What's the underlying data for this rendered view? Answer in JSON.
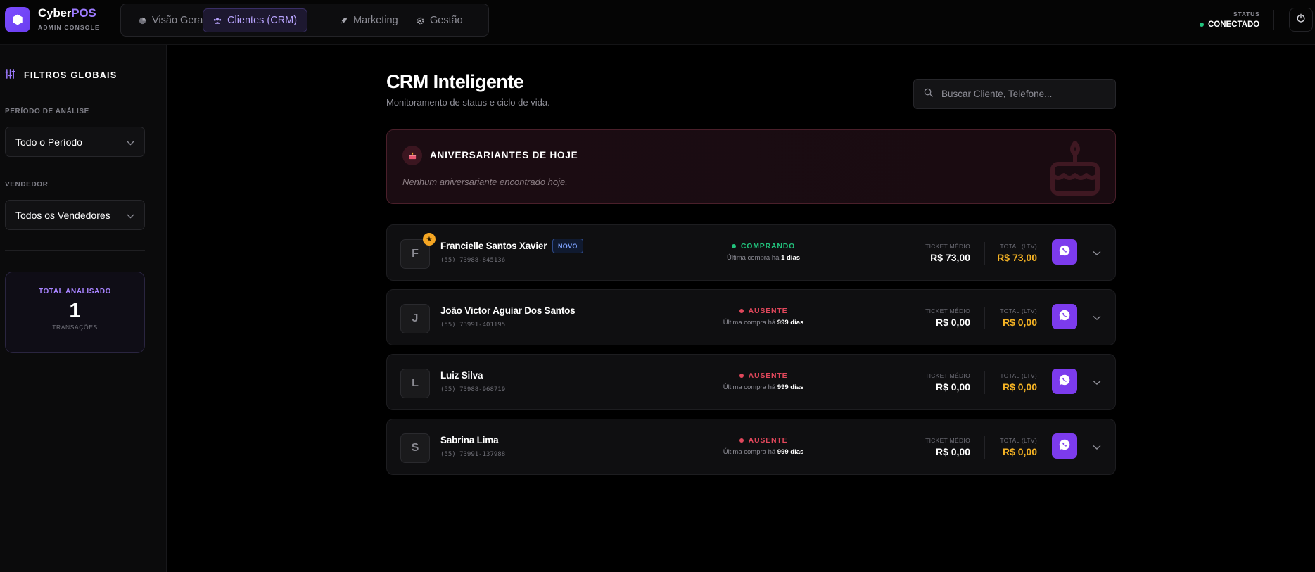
{
  "app": {
    "name_a": "Cyber",
    "name_b": "POS",
    "subtitle": "ADMIN CONSOLE"
  },
  "nav": [
    {
      "label": "Visão Geral",
      "icon": "chart-pie-icon",
      "active": false
    },
    {
      "label": "Clientes (CRM)",
      "icon": "users-icon",
      "active": true
    },
    {
      "label": "Marketing",
      "icon": "rocket-icon",
      "active": false
    },
    {
      "label": "Gestão",
      "icon": "gear-icon",
      "active": false
    }
  ],
  "status": {
    "label": "STATUS",
    "value": "CONECTADO"
  },
  "sidebar": {
    "title": "FILTROS GLOBAIS",
    "period_label": "PERÍODO DE ANÁLISE",
    "period_value": "Todo o Período",
    "seller_label": "VENDEDOR",
    "seller_value": "Todos os Vendedores",
    "total_title": "TOTAL ANALISADO",
    "total_value": "1",
    "total_sub": "TRANSAÇÕES"
  },
  "main": {
    "title": "CRM Inteligente",
    "subtitle": "Monitoramento de status e ciclo de vida.",
    "search_placeholder": "Buscar Cliente, Telefone..."
  },
  "birthday": {
    "title": "ANIVERSARIANTES DE HOJE",
    "empty": "Nenhum aniversariante encontrado hoje."
  },
  "labels": {
    "ticket": "TICKET MÉDIO",
    "ltv": "TOTAL (LTV)",
    "last_buy": "Última compra há"
  },
  "colors": {
    "accent": "#7c3bed",
    "active_status": "#22c37d",
    "away_status": "#e0475b",
    "ltv": "#f5b324"
  },
  "clients": [
    {
      "initial": "F",
      "name": "Francielle Santos Xavier",
      "badge": "NOVO",
      "star": true,
      "phone": "(55) 73988-845136",
      "status": "COMPRANDO",
      "status_type": "active",
      "days": "1 dias",
      "ticket": "R$ 73,00",
      "ltv": "R$ 73,00"
    },
    {
      "initial": "J",
      "name": "João Victor Aguiar Dos Santos",
      "badge": "",
      "star": false,
      "phone": "(55) 73991-401195",
      "status": "AUSENTE",
      "status_type": "away",
      "days": "999 dias",
      "ticket": "R$ 0,00",
      "ltv": "R$ 0,00"
    },
    {
      "initial": "L",
      "name": "Luiz Silva",
      "badge": "",
      "star": false,
      "phone": "(55) 73988-968719",
      "status": "AUSENTE",
      "status_type": "away",
      "days": "999 dias",
      "ticket": "R$ 0,00",
      "ltv": "R$ 0,00"
    },
    {
      "initial": "S",
      "name": "Sabrina Lima",
      "badge": "",
      "star": false,
      "phone": "(55) 73991-137988",
      "status": "AUSENTE",
      "status_type": "away",
      "days": "999 dias",
      "ticket": "R$ 0,00",
      "ltv": "R$ 0,00"
    }
  ]
}
